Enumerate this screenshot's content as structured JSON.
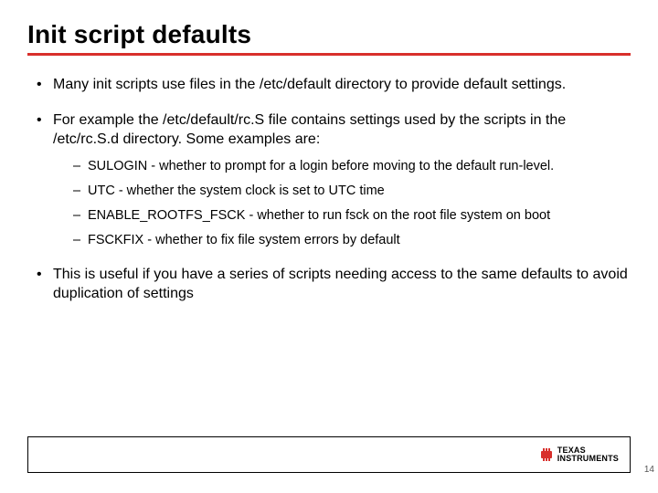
{
  "title": "Init script defaults",
  "bullets": {
    "b1": "Many init scripts use files in the /etc/default directory to provide default settings.",
    "b2": "For example the /etc/default/rc.S file contains settings used by the scripts in the /etc/rc.S.d directory.  Some examples are:",
    "sub": {
      "s1": "SULOGIN - whether to prompt for a login before moving to the default run-level.",
      "s2": "UTC - whether the system clock is set to UTC time",
      "s3": "ENABLE_ROOTFS_FSCK - whether to run fsck on the root file system on boot",
      "s4": "FSCKFIX - whether to fix file system errors by default"
    },
    "b3": "This is useful if you have a series of scripts needing access to the same defaults to avoid duplication of settings"
  },
  "logo": {
    "line1": "TEXAS",
    "line2": "INSTRUMENTS"
  },
  "page_number": "14",
  "colors": {
    "accent": "#d82f2b"
  }
}
